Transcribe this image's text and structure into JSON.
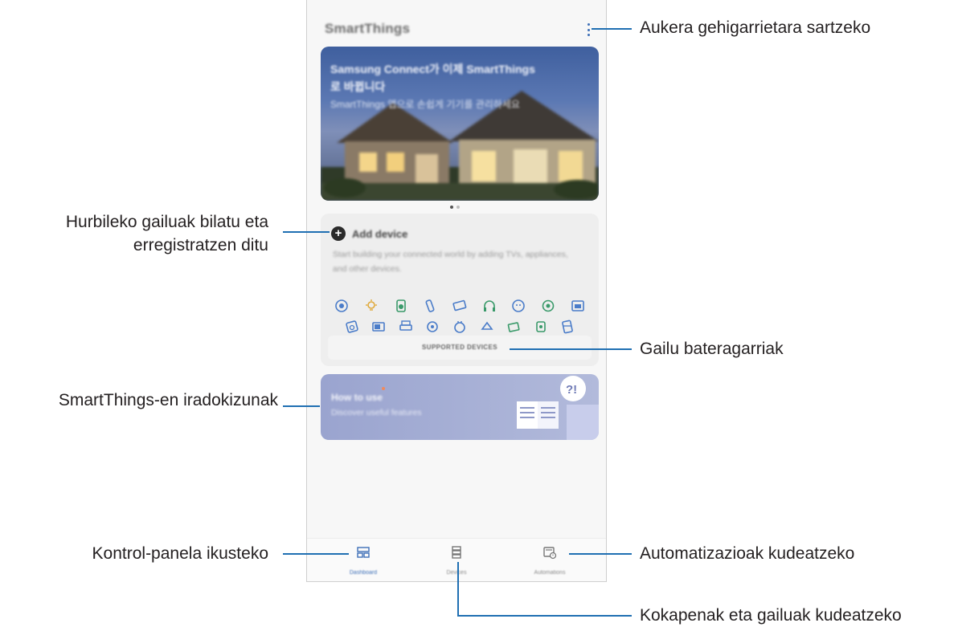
{
  "app": {
    "title": "SmartThings",
    "banner": {
      "line1": "Samsung Connect가 이제 SmartThings",
      "line2": "로 바뀝니다",
      "line3": "SmartThings 앱으로 손쉽게 기기를 관리하세요"
    },
    "add_device": {
      "label": "Add device",
      "description": "Start building your connected world by adding TVs, appliances, and other devices.",
      "supported_label": "SUPPORTED DEVICES"
    },
    "how_to_use": {
      "title": "How to use",
      "subtitle": "Discover useful features"
    },
    "nav": {
      "dashboard": "Dashboard",
      "devices": "Devices",
      "automations": "Automations"
    }
  },
  "callouts": {
    "more_options": "Aukera gehigarrietara sartzeko",
    "add_device_line1": "Hurbileko gailuak bilatu eta",
    "add_device_line2": "erregistratzen ditu",
    "supported_devices": "Gailu bateragarriak",
    "tutorials": "SmartThings-en iradokizunak",
    "dashboard": "Kontrol-panela ikusteko",
    "automations": "Automatizazioak kudeatzeko",
    "devices": "Kokapenak eta gailuak kudeatzeko"
  },
  "colors": {
    "callout_line": "#1f6fb2",
    "accent": "#3d6fb7",
    "banner": "#5b78b3",
    "howto_card": "#a7afd6"
  }
}
